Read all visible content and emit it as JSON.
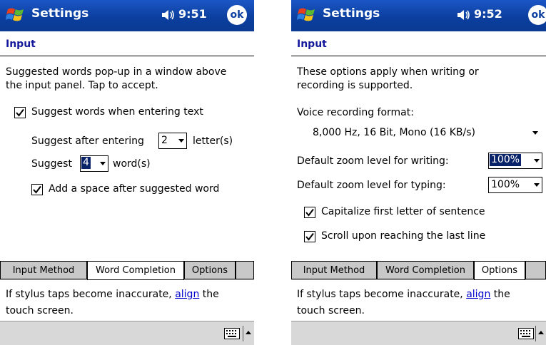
{
  "left": {
    "title": "Settings",
    "clock": "9:51",
    "ok_label": "ok",
    "heading": "Input",
    "description": "Suggested words pop-up in a window above the input panel. Tap to accept.",
    "suggest_words": {
      "label": "Suggest words when entering text",
      "checked": true
    },
    "suggest_after_label": "Suggest after entering",
    "suggest_after_value": "2",
    "letters_label": "letter(s)",
    "suggest_label": "Suggest",
    "suggest_count_value": "4",
    "words_label": "word(s)",
    "add_space": {
      "label": "Add a space after suggested word",
      "checked": true
    },
    "tabs": [
      {
        "label": "Input Method",
        "active": false
      },
      {
        "label": "Word Completion",
        "active": true
      },
      {
        "label": "Options",
        "active": false
      }
    ],
    "footer_prefix": "If stylus taps become inaccurate, ",
    "footer_link": "align",
    "footer_suffix": " the touch screen."
  },
  "right": {
    "title": "Settings",
    "clock": "9:52",
    "ok_label": "ok",
    "heading": "Input",
    "description": "These options apply when writing or recording is supported.",
    "voice_format_label": "Voice recording format:",
    "voice_format_value": "8,000 Hz, 16 Bit, Mono (16 KB/s)",
    "zoom_writing_label": "Default zoom level for writing:",
    "zoom_writing_value": "100%",
    "zoom_typing_label": "Default zoom level for typing:",
    "zoom_typing_value": "100%",
    "capitalize": {
      "label": "Capitalize first letter of sentence",
      "checked": true
    },
    "scroll": {
      "label": "Scroll upon reaching the last line",
      "checked": true
    },
    "tabs": [
      {
        "label": "Input Method",
        "active": false
      },
      {
        "label": "Word Completion",
        "active": false
      },
      {
        "label": "Options",
        "active": true
      }
    ],
    "footer_prefix": "If stylus taps become inaccurate, ",
    "footer_link": "align",
    "footer_suffix": " the touch screen."
  },
  "icons": {
    "start": "windows-flag-icon",
    "volume": "speaker-icon",
    "keyboard": "keyboard-icon",
    "sip": "chevron-up-icon"
  },
  "colors": {
    "titlebar": "#0b3f9f",
    "heading": "#14189c",
    "selection": "#0a246a",
    "link": "#0000cc",
    "tabbar": "#c8c8c8"
  }
}
